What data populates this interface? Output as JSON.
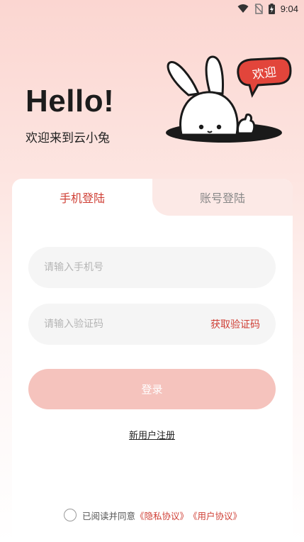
{
  "status_bar": {
    "time": "9:04",
    "icons": [
      "wifi-icon",
      "no-sim-icon",
      "battery-charging-icon"
    ]
  },
  "hero": {
    "title": "Hello!",
    "subtitle": "欢迎来到云小兔",
    "mascot_badge": "欢迎"
  },
  "tabs": [
    {
      "label": "手机登陆",
      "active": true
    },
    {
      "label": "账号登陆",
      "active": false
    }
  ],
  "form": {
    "phone_placeholder": "请输入手机号",
    "code_placeholder": "请输入验证码",
    "get_code_label": "获取验证码",
    "login_label": "登录",
    "register_label": "新用户注册"
  },
  "agreement": {
    "prefix": "已阅读并同意",
    "privacy": "《隐私协议》",
    "user": "《用户协议》"
  },
  "colors": {
    "accent": "#cf3f35",
    "button_disabled": "#f5c3bd",
    "gradient_top": "#fbd6d1"
  }
}
